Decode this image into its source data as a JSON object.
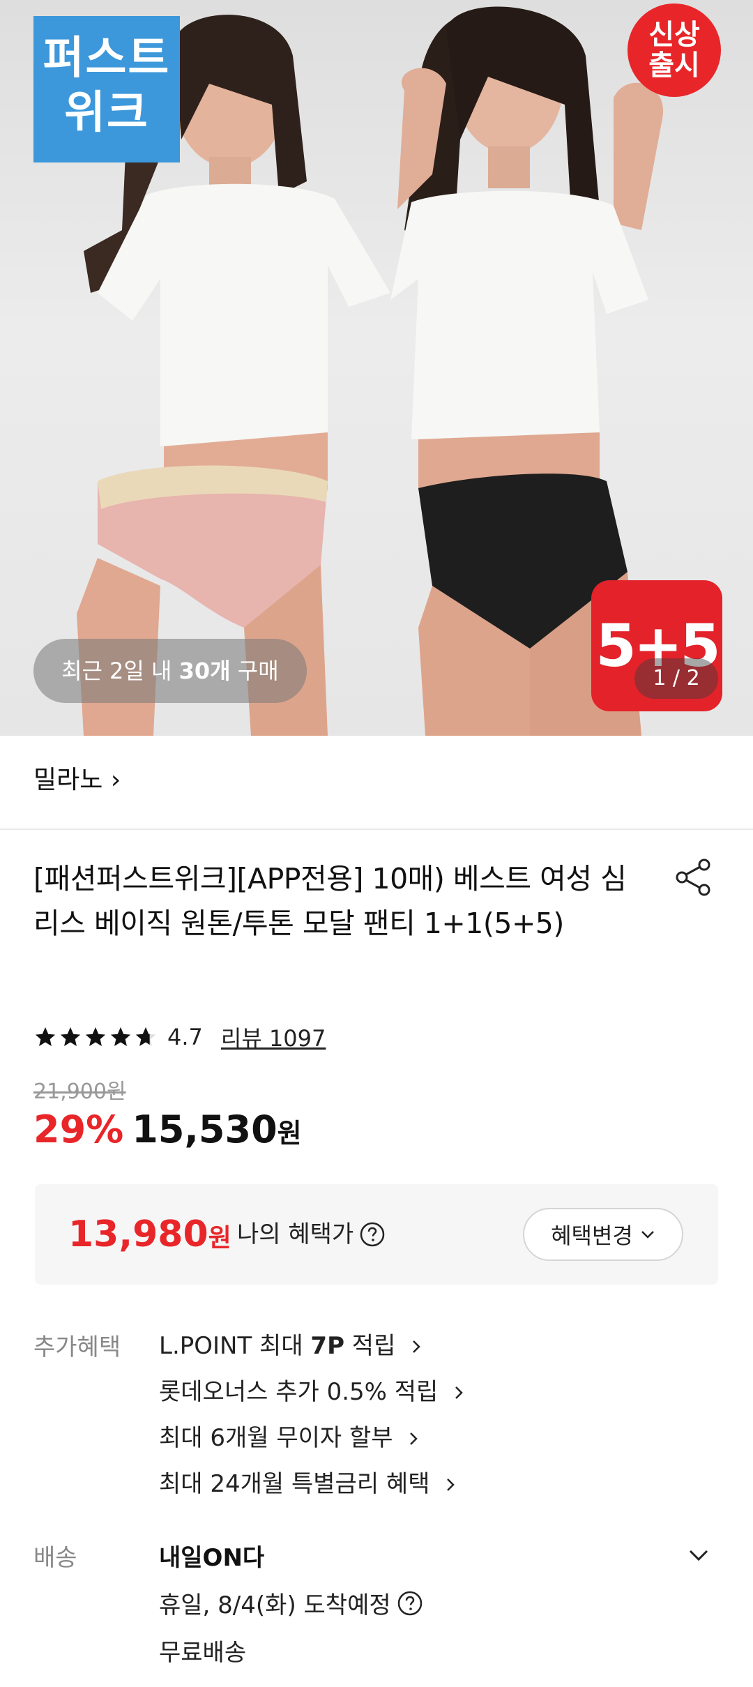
{
  "hero": {
    "badge_top_left": [
      "퍼스트",
      "위크"
    ],
    "badge_new": [
      "신상",
      "출시"
    ],
    "badge_promo": "5+5",
    "recent_purchase": {
      "prefix": "최근 2일 내 ",
      "count": "30개",
      "suffix": " 구매"
    },
    "pager": "1 / 2"
  },
  "brand": {
    "name": "밀라노",
    "chevron": "›"
  },
  "product": {
    "title": "[패션퍼스트위크][APP전용] 10매) 베스트 여성 심리스 베이직 원톤/투톤 모달 팬티 1+1(5+5)",
    "rating": "4.7",
    "rating_stars": 4.7,
    "review_link": "리뷰 1097"
  },
  "price": {
    "original": "21,900원",
    "discount": "29%",
    "sale": "15,530",
    "won": "원"
  },
  "benefit_box": {
    "price": "13,980",
    "won": "원",
    "label": "나의 혜택가",
    "change_button": "혜택변경"
  },
  "extra_benefits": {
    "label": "추가혜택",
    "items": [
      {
        "pre": "L.POINT 최대 ",
        "bold": "7P",
        "post": " 적립"
      },
      {
        "pre": "롯데오너스 추가 0.5% 적립",
        "bold": "",
        "post": ""
      },
      {
        "pre": "최대 6개월 무이자 할부",
        "bold": "",
        "post": ""
      },
      {
        "pre": "최대 24개월 특별금리 혜택",
        "bold": "",
        "post": ""
      }
    ]
  },
  "delivery": {
    "label": "배송",
    "title": "내일ON다",
    "arrival": "휴일, 8/4(화) 도착예정",
    "shipping": "무료배송"
  },
  "colors": {
    "accent_red": "#e8262a",
    "badge_blue": "#3d98db",
    "muted_gray": "#888888"
  },
  "icons": [
    "share-icon",
    "star-icon",
    "help-icon",
    "chevron-down-icon",
    "chevron-right-icon"
  ]
}
